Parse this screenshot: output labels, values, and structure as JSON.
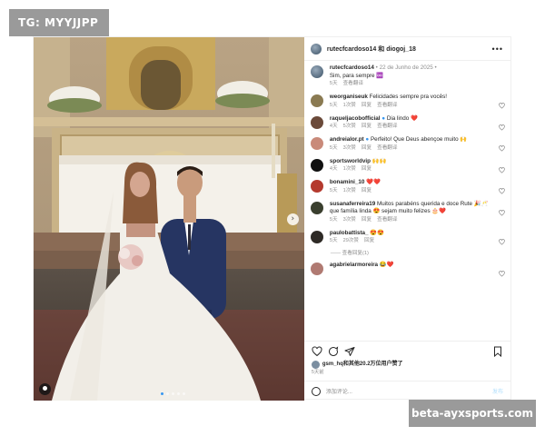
{
  "watermark_top": "TG: MYYJJPP",
  "watermark_bottom": "beta-ayxsports.com",
  "header": {
    "usernames": "rutecfcardoso14 和 diogoj_18",
    "more_icon": "more-horizontal-icon"
  },
  "caption": {
    "user": "rutecfcardoso14",
    "date": " • 22 de Junho de 2025 •",
    "text": "Sim, para sempre ♾️",
    "time": "5天",
    "translate": "查看翻译"
  },
  "comments": [
    {
      "user": "weorganiseuk",
      "text": "Felicidades sempre pra vocês!",
      "time": "5天",
      "likes": "1次赞",
      "reply": "回复",
      "translate": "查看翻译",
      "avatar_color": "#8a7a52",
      "verified": false
    },
    {
      "user": "raqueljacobofficial",
      "text": "Dia lindo ❤️",
      "time": "4天",
      "likes": "5次赞",
      "reply": "回复",
      "translate": "查看翻译",
      "avatar_color": "#6b4a3a",
      "verified": true
    },
    {
      "user": "andreialor.pt",
      "text": "Perfeito! Que Deus abençoe muito 🙌",
      "time": "5天",
      "likes": "3次赞",
      "reply": "回复",
      "translate": "查看翻译",
      "avatar_color": "#c98a7a",
      "verified": true
    },
    {
      "user": "sportsworldvip",
      "text": "🙌🙌",
      "time": "4天",
      "likes": "1次赞",
      "reply": "回复",
      "translate": "",
      "avatar_color": "#111111",
      "verified": false
    },
    {
      "user": "bonamini_10",
      "text": "❤️❤️",
      "time": "5天",
      "likes": "1次赞",
      "reply": "回复",
      "translate": "",
      "avatar_color": "#b43a2e",
      "verified": false
    },
    {
      "user": "susanaferreira19",
      "text": "Muitos parabéns querida e doce Rute 🎉🥂 que família linda 😍 sejam muito felizes 🎂❤️",
      "time": "5天",
      "likes": "3次赞",
      "reply": "回复",
      "translate": "查看翻译",
      "avatar_color": "#3a3f2e",
      "verified": false
    },
    {
      "user": "paulobattista_",
      "text": "😍😍",
      "time": "5天",
      "likes": "29次赞",
      "reply": "回复",
      "translate": "",
      "avatar_color": "#2e2a26",
      "verified": false
    },
    {
      "user": "agabrielarmoreira",
      "text": "😂❤️",
      "time": "",
      "likes": "",
      "reply": "",
      "translate": "",
      "avatar_color": "#b07a72",
      "verified": false
    }
  ],
  "view_replies": "—— 查看回复(1)",
  "likes_text": "gsm_hq和其他20.2万位用户赞了",
  "post_time": "5天前",
  "add_comment_placeholder": "添加评论...",
  "post_button": "发布",
  "icons": {
    "like": "heart-icon",
    "comment": "comment-icon",
    "share": "share-icon",
    "save": "bookmark-icon",
    "emoji": "emoji-icon",
    "next": "chevron-right-icon",
    "tag": "user-tag-icon"
  }
}
